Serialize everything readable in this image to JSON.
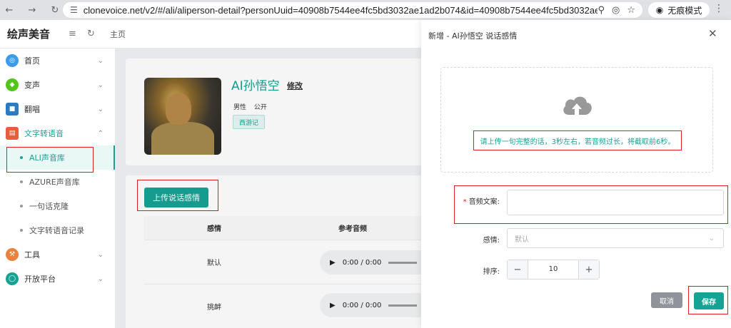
{
  "browser": {
    "url": "clonevoice.net/v2/#/ali/aliperson-detail?personUuid=40908b7544ee4fc5bd3032ae1ad2b074&id=40908b7544ee4fc5bd3032ae1...",
    "incognito_label": "无痕模式"
  },
  "header": {
    "logo": "绘声美音",
    "breadcrumb": "主页"
  },
  "sidebar": {
    "items": [
      {
        "label": "首页",
        "color": "#3d9be9"
      },
      {
        "label": "变声",
        "color": "#52c41a"
      },
      {
        "label": "翻唱",
        "color": "#2a7bbf"
      },
      {
        "label": "文字转语音",
        "color": "#e85d3c"
      }
    ],
    "sub_items": [
      {
        "label": "ALI声音库"
      },
      {
        "label": "AZURE声音库"
      },
      {
        "label": "一句话克隆"
      },
      {
        "label": "文字转语音记录"
      }
    ],
    "bottom_items": [
      {
        "label": "工具",
        "color": "#e8823c"
      },
      {
        "label": "开放平台",
        "color": "#16a394"
      }
    ]
  },
  "person": {
    "name": "AI孙悟空",
    "edit_label": "修改",
    "gender": "男性",
    "visibility": "公开",
    "tag": "西游记"
  },
  "emotions": {
    "upload_button": "上传说话感情",
    "columns": [
      "感情",
      "参考音频"
    ],
    "rows": [
      {
        "emotion": "默认",
        "time": "0:00 / 0:00"
      },
      {
        "emotion": "挑衅",
        "time": "0:00 / 0:00"
      }
    ]
  },
  "drawer": {
    "title": "新增 - AI孙悟空 说话感情",
    "upload_hint": "请上传一句完整的话，3秒左右，若音频过长，将截取前6秒。",
    "text_label": "音频文案:",
    "emotion_label": "感情:",
    "emotion_placeholder": "默认",
    "order_label": "排序:",
    "order_value": "10",
    "cancel_label": "取消",
    "save_label": "保存"
  },
  "colors": {
    "accent": "#16a394",
    "highlight_red": "#e02020"
  }
}
